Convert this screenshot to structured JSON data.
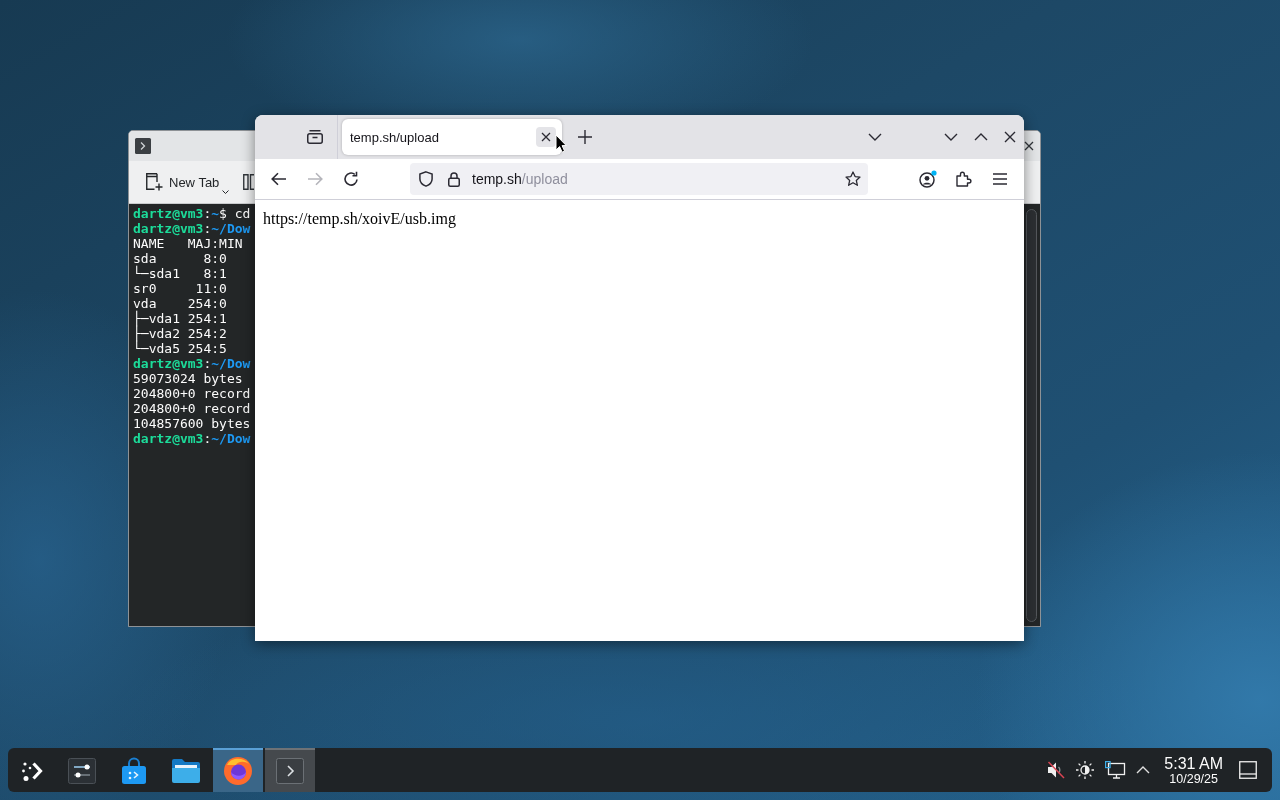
{
  "terminal": {
    "new_tab": "New Tab",
    "lines": [
      {
        "segments": [
          {
            "kind": "user",
            "text": "dartz@vm3"
          },
          {
            "kind": "plain",
            "text": ":"
          },
          {
            "kind": "path",
            "text": "~"
          },
          {
            "kind": "plain",
            "text": "$ cd"
          }
        ]
      },
      {
        "segments": [
          {
            "kind": "user",
            "text": "dartz@vm3"
          },
          {
            "kind": "plain",
            "text": ":"
          },
          {
            "kind": "path",
            "text": "~/Dow"
          }
        ]
      },
      {
        "segments": [
          {
            "kind": "plain",
            "text": "NAME   MAJ:MIN"
          }
        ]
      },
      {
        "segments": [
          {
            "kind": "plain",
            "text": "sda      8:0"
          }
        ]
      },
      {
        "segments": [
          {
            "kind": "plain",
            "text": "└─sda1   8:1"
          }
        ]
      },
      {
        "segments": [
          {
            "kind": "plain",
            "text": "sr0     11:0"
          }
        ]
      },
      {
        "segments": [
          {
            "kind": "plain",
            "text": "vda    254:0"
          }
        ]
      },
      {
        "segments": [
          {
            "kind": "plain",
            "text": "├─vda1 254:1"
          }
        ]
      },
      {
        "segments": [
          {
            "kind": "plain",
            "text": "├─vda2 254:2"
          }
        ]
      },
      {
        "segments": [
          {
            "kind": "plain",
            "text": "└─vda5 254:5"
          }
        ]
      },
      {
        "segments": [
          {
            "kind": "user",
            "text": "dartz@vm3"
          },
          {
            "kind": "plain",
            "text": ":"
          },
          {
            "kind": "path",
            "text": "~/Dow"
          }
        ]
      },
      {
        "segments": [
          {
            "kind": "plain",
            "text": "59073024 bytes"
          }
        ]
      },
      {
        "segments": [
          {
            "kind": "plain",
            "text": "204800+0 record"
          }
        ]
      },
      {
        "segments": [
          {
            "kind": "plain",
            "text": "204800+0 record"
          }
        ]
      },
      {
        "segments": [
          {
            "kind": "plain",
            "text": "104857600 bytes"
          }
        ]
      },
      {
        "segments": [
          {
            "kind": "user",
            "text": "dartz@vm3"
          },
          {
            "kind": "plain",
            "text": ":"
          },
          {
            "kind": "path",
            "text": "~/Dow"
          }
        ]
      }
    ]
  },
  "browser": {
    "tabs": [
      {
        "label": "temp.sh/upload",
        "selected": true
      }
    ],
    "nav_buttons": [
      {
        "kind": "back",
        "disabled": false
      },
      {
        "kind": "forward",
        "disabled": true
      },
      {
        "kind": "reload",
        "disabled": false
      }
    ],
    "address": {
      "host": "temp.sh",
      "path": "/upload"
    },
    "page_text": "https://temp.sh/xoivE/usb.img"
  },
  "taskbar": {
    "apps": [
      {
        "kind": "launcher",
        "open": false,
        "active": false
      },
      {
        "kind": "settings",
        "open": false,
        "active": false
      },
      {
        "kind": "store",
        "open": false,
        "active": false
      },
      {
        "kind": "files",
        "open": false,
        "active": false
      },
      {
        "kind": "browser",
        "open": true,
        "active": true
      },
      {
        "kind": "terminal",
        "open": true,
        "active": false
      }
    ],
    "tray": [
      {
        "kind": "volume",
        "muted": true
      },
      {
        "kind": "brightness"
      },
      {
        "kind": "network"
      },
      {
        "kind": "expand"
      }
    ],
    "clock": {
      "time": "5:31 AM",
      "date": "10/29/25"
    }
  }
}
